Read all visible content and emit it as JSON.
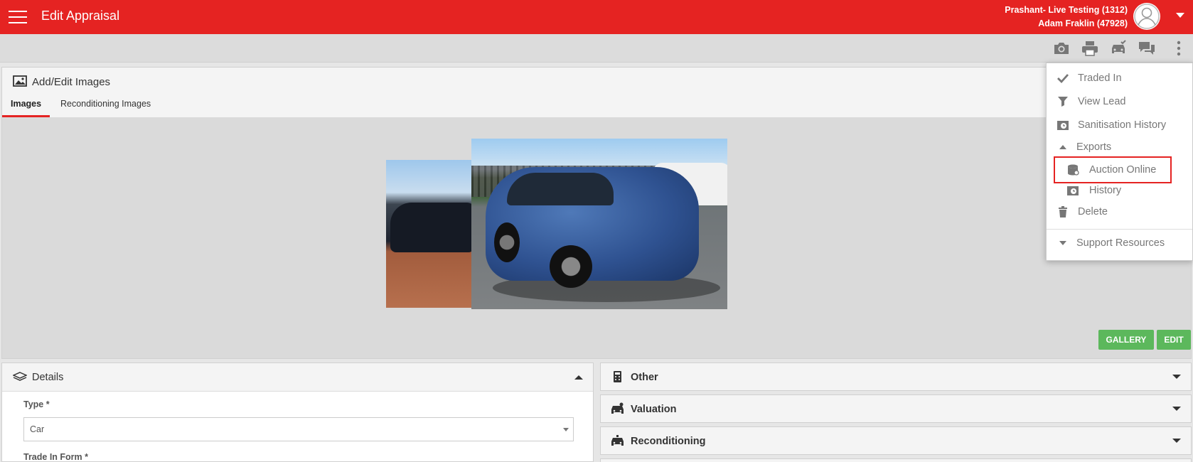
{
  "header": {
    "title": "Edit Appraisal",
    "user_line1": "Prashant- Live Testing (1312)",
    "user_line2": "Adam Fraklin (47928)",
    "accent_color": "#e52322"
  },
  "toolbar": {
    "icons": [
      "camera-icon",
      "print-icon",
      "car-check-icon",
      "chat-icon",
      "more-vertical-icon"
    ]
  },
  "images": {
    "title": "Add/Edit Images",
    "tabs": [
      {
        "label": "Images",
        "active": true
      },
      {
        "label": "Reconditioning Images",
        "active": false
      }
    ],
    "gallery_label": "GALLERY",
    "edit_label": "EDIT"
  },
  "details": {
    "title": "Details",
    "type_label": "Type *",
    "type_value": "Car",
    "trade_in_label": "Trade In Form *"
  },
  "accordions": [
    {
      "title": "Other",
      "icon": "calculator-icon"
    },
    {
      "title": "Valuation",
      "icon": "car-dollar-icon"
    },
    {
      "title": "Reconditioning",
      "icon": "car-wrench-icon"
    }
  ],
  "menu": {
    "items": [
      {
        "label": "Traded In",
        "icon": "check-icon"
      },
      {
        "label": "View Lead",
        "icon": "funnel-icon"
      },
      {
        "label": "Sanitisation History",
        "icon": "history-icon"
      },
      {
        "label": "Exports",
        "icon": "caret-up-icon"
      },
      {
        "label": "Auction Online",
        "icon": "database-icon"
      },
      {
        "label": "History",
        "icon": "history-icon"
      },
      {
        "label": "Delete",
        "icon": "trash-icon"
      },
      {
        "label": "Support Resources",
        "icon": "caret-down-icon"
      }
    ]
  }
}
